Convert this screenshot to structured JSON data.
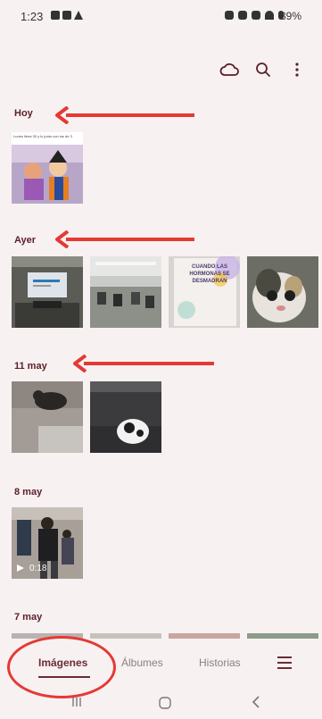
{
  "status_bar": {
    "time": "1:23",
    "battery": "39%"
  },
  "toolbar": {
    "icons": [
      "cloud-icon",
      "search-icon",
      "more-vertical-icon"
    ]
  },
  "sections": [
    {
      "label": "Hoy",
      "thumbs": [
        {
          "name": "cartoon-screenshot",
          "caption": "Lunes llena 30 y lo junto con los de 3"
        }
      ]
    },
    {
      "label": "Ayer",
      "thumbs": [
        {
          "name": "classroom-projector"
        },
        {
          "name": "classroom-wide"
        },
        {
          "name": "book-cover",
          "book_title": "CUANDO LAS HORMONAS SE DESMADRAN"
        },
        {
          "name": "cat-meme"
        }
      ]
    },
    {
      "label": "11 may",
      "thumbs": [
        {
          "name": "cat-on-rug"
        },
        {
          "name": "cat-on-cushion"
        }
      ]
    },
    {
      "label": "8 may",
      "thumbs": [
        {
          "name": "video-people",
          "duration": "0:18"
        }
      ]
    },
    {
      "label": "7 may",
      "thumbs": []
    }
  ],
  "bottom_nav": {
    "tabs": [
      {
        "label": "Imágenes",
        "active": true
      },
      {
        "label": "Álbumes",
        "active": false
      },
      {
        "label": "Historias",
        "active": false
      }
    ]
  },
  "colors": {
    "background": "#f8f1f1",
    "accent": "#6b2c36",
    "annotation": "#e53935"
  }
}
